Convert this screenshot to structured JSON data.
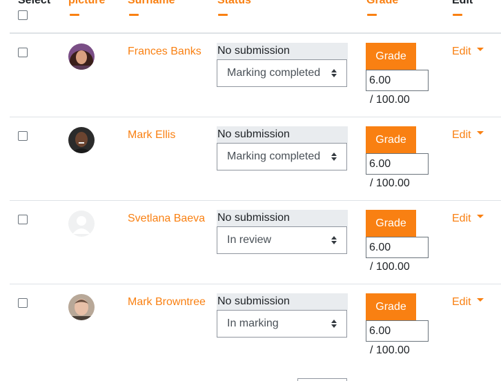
{
  "header": {
    "select": "Select",
    "picture": "picture",
    "surname": "Surname",
    "status": "Status",
    "grade": "Grade",
    "edit": "Edit"
  },
  "rows": [
    {
      "name": "Frances Banks",
      "status": "No submission",
      "marking": "Marking completed",
      "grade_button": "Grade",
      "grade_value": "6.00",
      "grade_max": "/ 100.00",
      "edit": "Edit",
      "avatar": "photo-woman-curly-hair"
    },
    {
      "name": "Mark Ellis",
      "status": "No submission",
      "marking": "Marking completed",
      "grade_button": "Grade",
      "grade_value": "6.00",
      "grade_max": "/ 100.00",
      "edit": "Edit",
      "avatar": "photo-man-dark-skin"
    },
    {
      "name": "Svetlana Baeva",
      "status": "No submission",
      "marking": "In review",
      "grade_button": "Grade",
      "grade_value": "6.00",
      "grade_max": "/ 100.00",
      "edit": "Edit",
      "avatar": "default-user-icon"
    },
    {
      "name": "Mark Browntree",
      "status": "No submission",
      "marking": "In marking",
      "grade_button": "Grade",
      "grade_value": "6.00",
      "grade_max": "/ 100.00",
      "edit": "Edit",
      "avatar": "photo-man-light-hair"
    }
  ],
  "colors": {
    "accent": "#f98012",
    "status_bg": "#e9ecef",
    "border": "#dee2e6"
  }
}
